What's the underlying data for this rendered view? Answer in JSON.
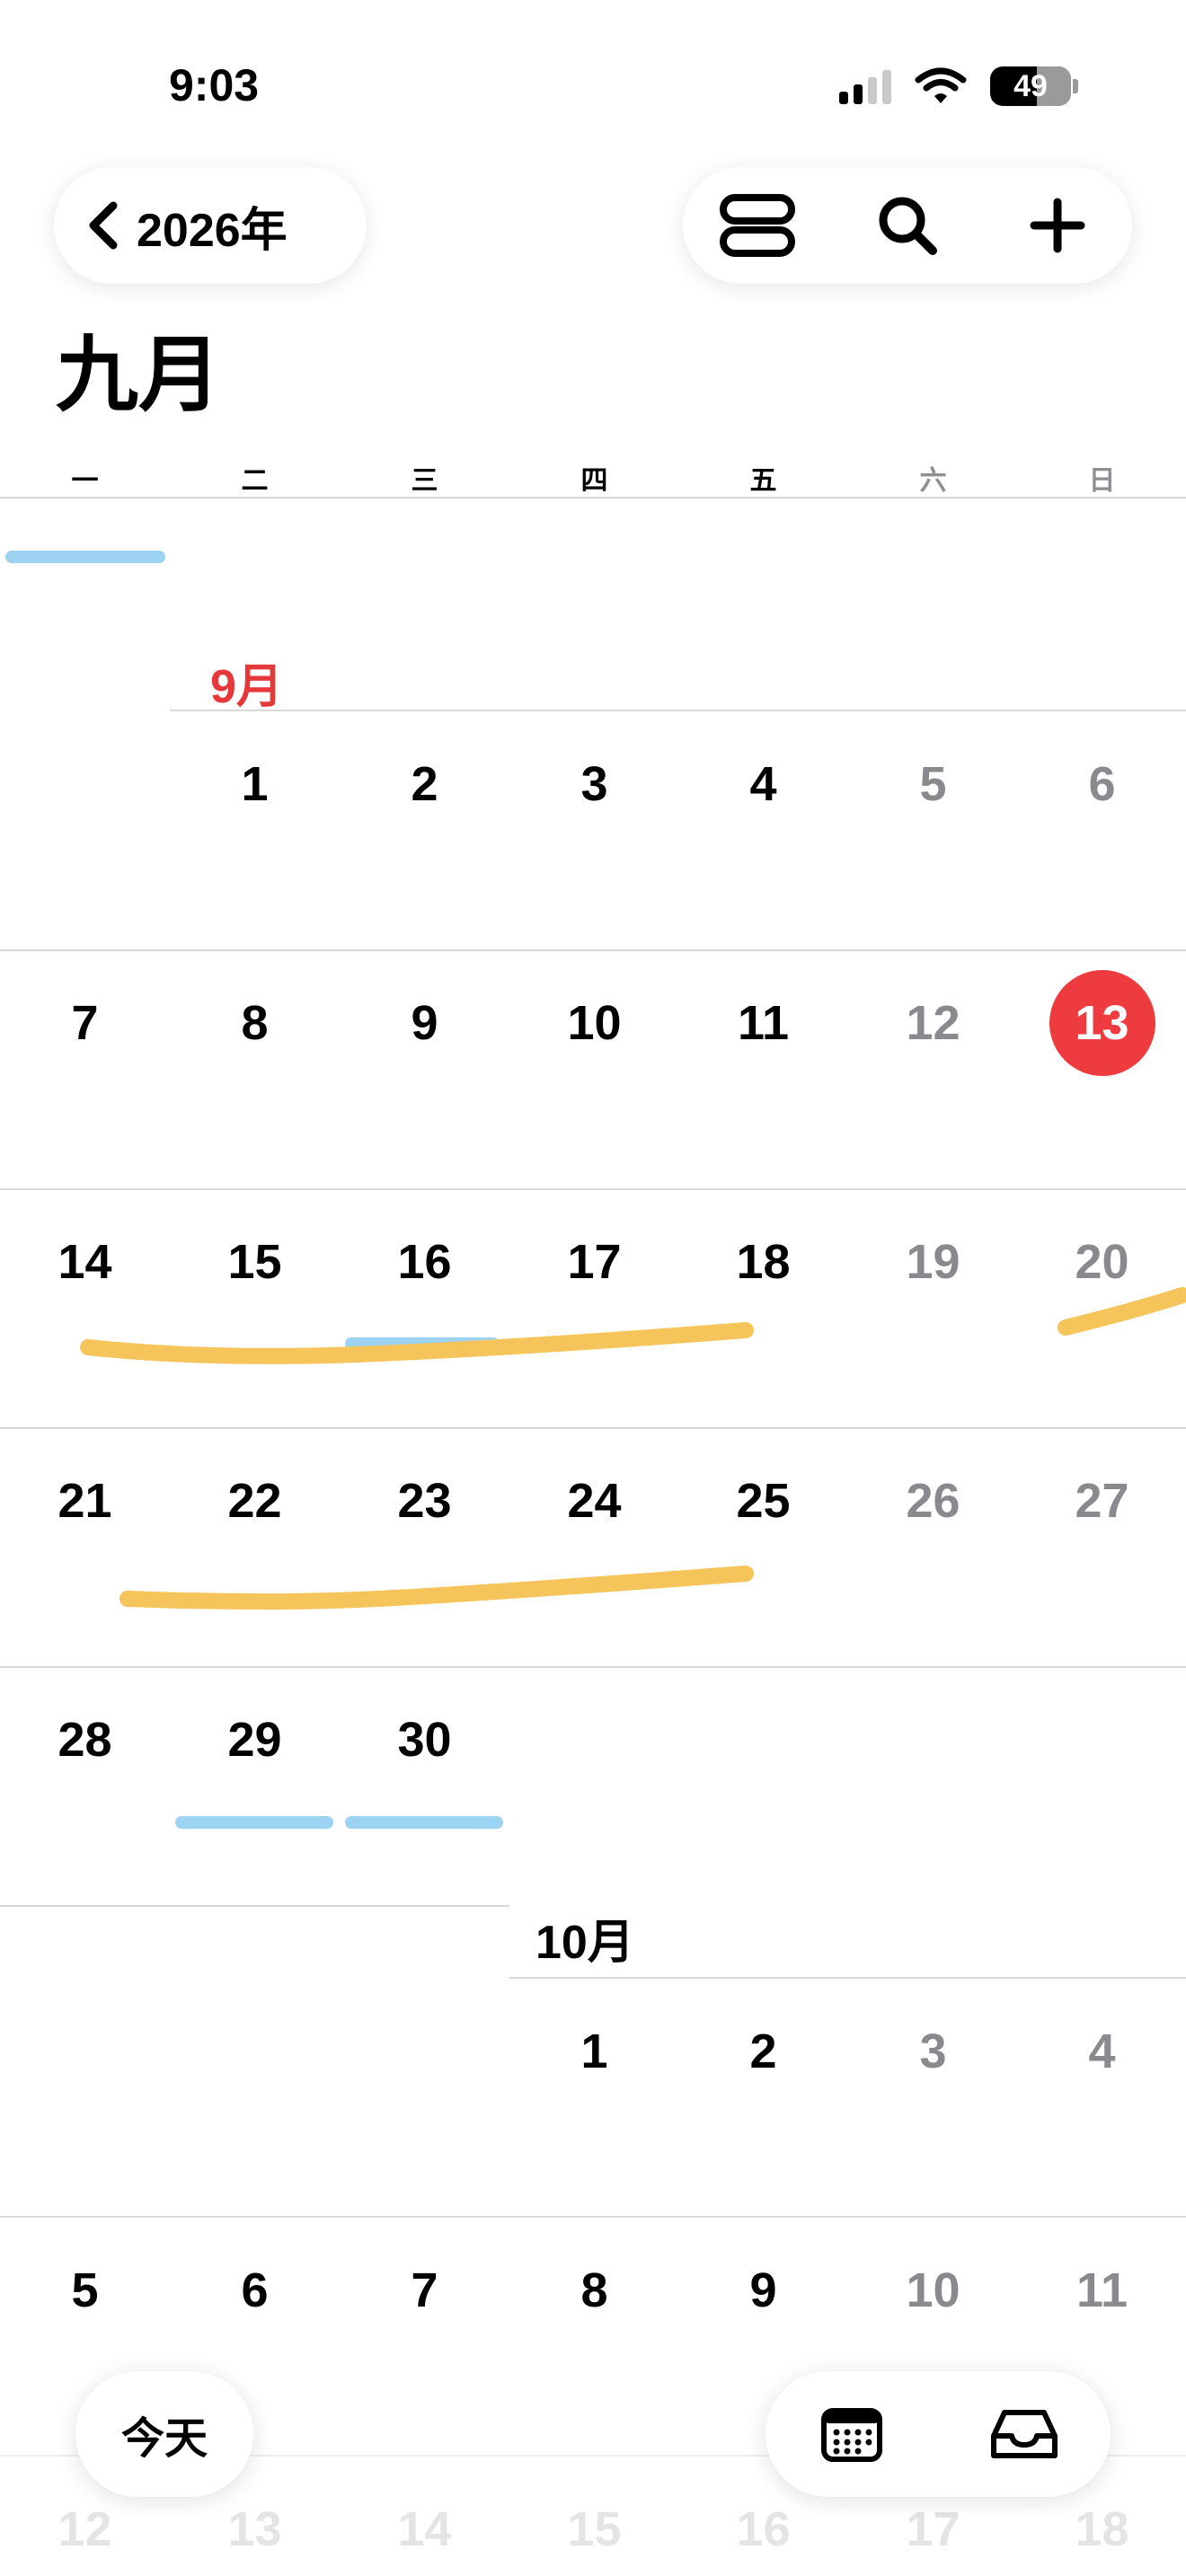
{
  "status_bar": {
    "time": "9:03",
    "battery": "49",
    "icons": [
      "signal-icon",
      "wifi-icon",
      "battery-icon"
    ]
  },
  "header": {
    "back_label": "2026年",
    "actions": [
      "view-toggle-icon",
      "search-icon",
      "add-icon"
    ]
  },
  "calendar": {
    "month_title": "九月",
    "weekdays": [
      "一",
      "二",
      "三",
      "四",
      "五",
      "六",
      "日"
    ],
    "months": [
      {
        "label": "9月",
        "current": true,
        "today": 13,
        "weeks": [
          [
            "",
            "1",
            "2",
            "3",
            "4",
            "5",
            "6"
          ],
          [
            "7",
            "8",
            "9",
            "10",
            "11",
            "12",
            "13"
          ],
          [
            "14",
            "15",
            "16",
            "17",
            "18",
            "19",
            "20"
          ],
          [
            "21",
            "22",
            "23",
            "24",
            "25",
            "26",
            "27"
          ],
          [
            "28",
            "29",
            "30",
            "",
            "",
            "",
            ""
          ]
        ]
      },
      {
        "label": "10月",
        "current": false,
        "weeks": [
          [
            "",
            "",
            "",
            "1",
            "2",
            "3",
            "4"
          ],
          [
            "5",
            "6",
            "7",
            "8",
            "9",
            "10",
            "11"
          ],
          [
            "12",
            "13",
            "14",
            "15",
            "16",
            "17",
            "18"
          ]
        ]
      }
    ]
  },
  "colors": {
    "accent_red": "#ee3b3f",
    "event_blue": "#9dd3f2",
    "highlight_yellow": "#f5c45b",
    "weekend_gray": "#8a8a8e"
  },
  "bottom_bar": {
    "today_label": "今天",
    "icons": [
      "calendar-grid-icon",
      "inbox-icon"
    ]
  }
}
